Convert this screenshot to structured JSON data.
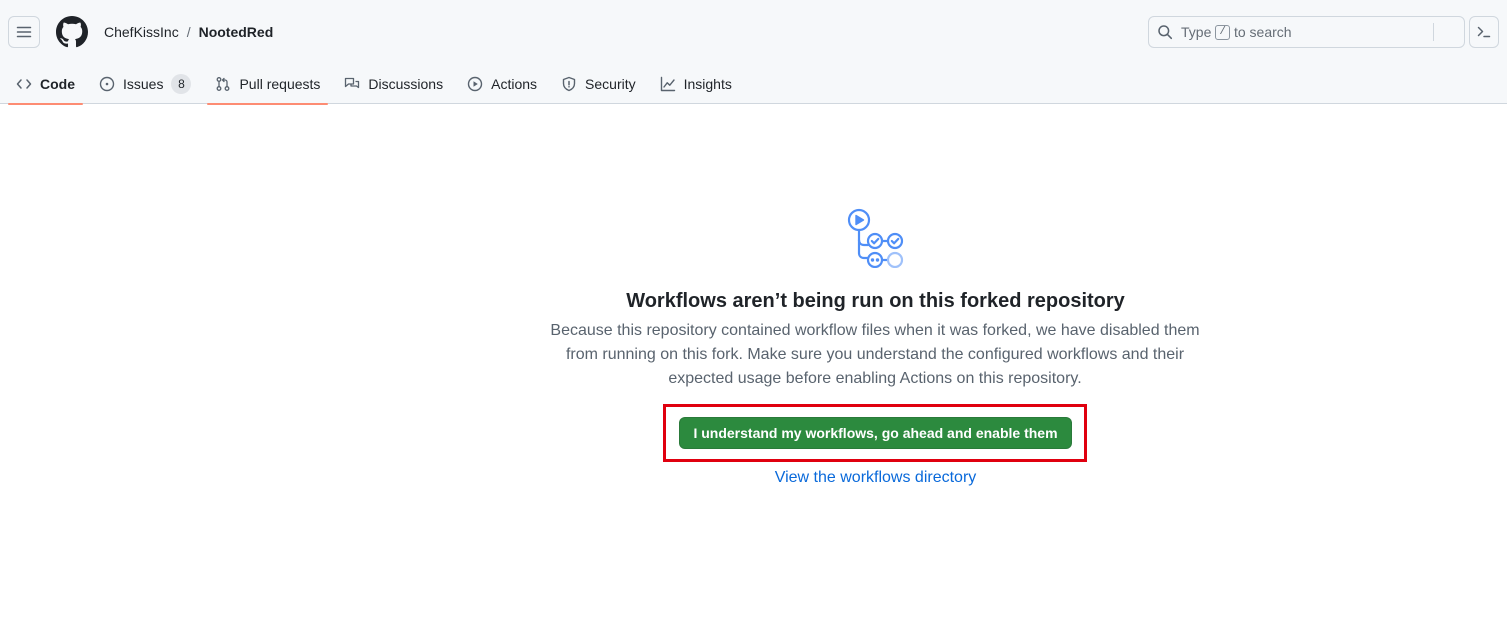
{
  "header": {
    "breadcrumb": {
      "owner": "ChefKissInc",
      "separator": "/",
      "repo": "NootedRed"
    },
    "search": {
      "prefix": "Type",
      "key": "/",
      "suffix": "to search"
    }
  },
  "nav": {
    "tabs": [
      {
        "label": "Code",
        "icon": "code-icon",
        "selected": true
      },
      {
        "label": "Issues",
        "icon": "issue-opened-icon",
        "count": "8"
      },
      {
        "label": "Pull requests",
        "icon": "git-pull-request-icon"
      },
      {
        "label": "Discussions",
        "icon": "comment-discussion-icon"
      },
      {
        "label": "Actions",
        "icon": "play-icon"
      },
      {
        "label": "Security",
        "icon": "shield-icon"
      },
      {
        "label": "Insights",
        "icon": "graph-icon"
      }
    ]
  },
  "main": {
    "title": "Workflows aren’t being run on this forked repository",
    "description": "Because this repository contained workflow files when it was forked, we have disabled them from running on this fork. Make sure you understand the configured workflows and their expected usage before enabling Actions on this repository.",
    "enable_button": "I understand my workflows, go ahead and enable them",
    "view_link": "View the workflows directory"
  },
  "colors": {
    "accent_green": "#2c8a3e",
    "link_blue": "#0969da",
    "tab_underline": "#fd8c73",
    "highlight_red": "#e0000f",
    "workflow_icon_blue": "#4f8ef7"
  }
}
